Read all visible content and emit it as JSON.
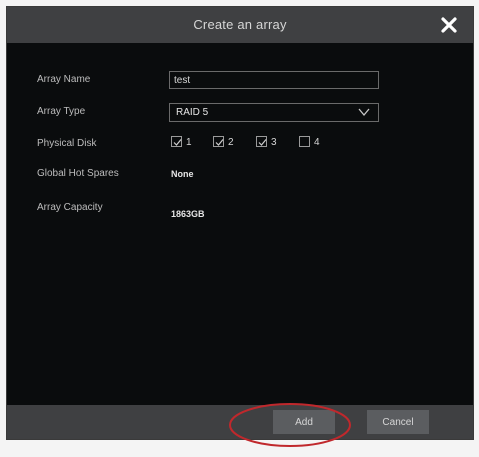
{
  "dialog": {
    "title": "Create an array",
    "close_icon": "close-icon"
  },
  "form": {
    "array_name": {
      "label": "Array Name",
      "value": "test"
    },
    "array_type": {
      "label": "Array Type",
      "value": "RAID 5",
      "arrow_icon": "chevron-down-icon"
    },
    "physical_disk": {
      "label": "Physical Disk",
      "disks": [
        {
          "number": "1",
          "checked": true
        },
        {
          "number": "2",
          "checked": true
        },
        {
          "number": "3",
          "checked": true
        },
        {
          "number": "4",
          "checked": false
        }
      ]
    },
    "global_hot_spares": {
      "label": "Global Hot Spares",
      "value": "None"
    },
    "array_capacity": {
      "label": "Array Capacity",
      "value": "1863GB"
    }
  },
  "footer": {
    "add_label": "Add",
    "cancel_label": "Cancel"
  },
  "colors": {
    "background": "#0a0c0d",
    "bar": "#3f4042",
    "button": "#5b5d60",
    "annotation": "#c0282c"
  }
}
